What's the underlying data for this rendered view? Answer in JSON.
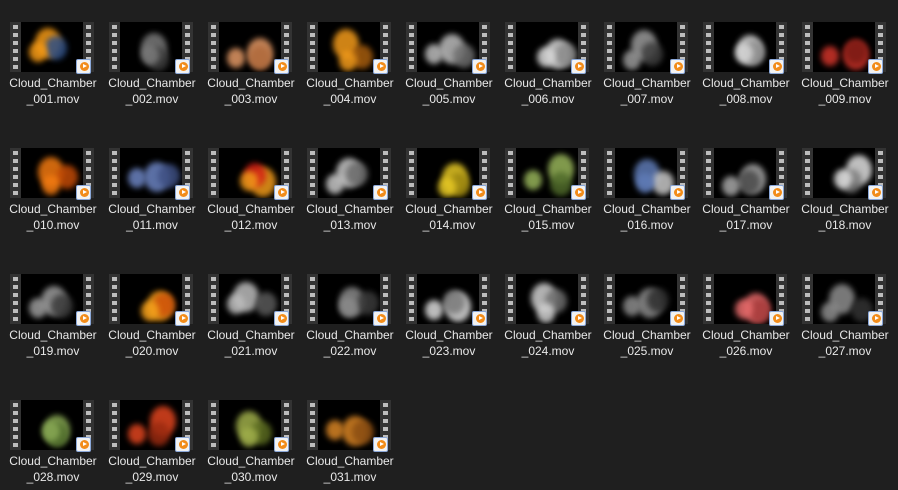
{
  "files": [
    {
      "name1": "Cloud_Chamber",
      "name2": "_001.mov",
      "c1": "#f59a16",
      "c2": "#2e4f86"
    },
    {
      "name1": "Cloud_Chamber",
      "name2": "_002.mov",
      "c1": "#7a7a7a",
      "c2": "#3c3c3c"
    },
    {
      "name1": "Cloud_Chamber",
      "name2": "_003.mov",
      "c1": "#e29865",
      "c2": "#b06a3c"
    },
    {
      "name1": "Cloud_Chamber",
      "name2": "_004.mov",
      "c1": "#f39b1b",
      "c2": "#a65d0e"
    },
    {
      "name1": "Cloud_Chamber",
      "name2": "_005.mov",
      "c1": "#bdbdbd",
      "c2": "#6d6d6d"
    },
    {
      "name1": "Cloud_Chamber",
      "name2": "_006.mov",
      "c1": "#d8d8d8",
      "c2": "#8a8a8a"
    },
    {
      "name1": "Cloud_Chamber",
      "name2": "_007.mov",
      "c1": "#9a9a9a",
      "c2": "#3e3e3e"
    },
    {
      "name1": "Cloud_Chamber",
      "name2": "_008.mov",
      "c1": "#d6d6d6",
      "c2": "#8c8c8c"
    },
    {
      "name1": "Cloud_Chamber",
      "name2": "_009.mov",
      "c1": "#d0342a",
      "c2": "#7a1a14"
    },
    {
      "name1": "Cloud_Chamber",
      "name2": "_010.mov",
      "c1": "#f27a11",
      "c2": "#c24a06"
    },
    {
      "name1": "Cloud_Chamber",
      "name2": "_011.mov",
      "c1": "#6c84c2",
      "c2": "#3e4f82"
    },
    {
      "name1": "Cloud_Chamber",
      "name2": "_012.mov",
      "c1": "#f09a1a",
      "c2": "#d42016"
    },
    {
      "name1": "Cloud_Chamber",
      "name2": "_013.mov",
      "c1": "#c8c8c8",
      "c2": "#6a6a6a"
    },
    {
      "name1": "Cloud_Chamber",
      "name2": "_014.mov",
      "c1": "#e6c825",
      "c2": "#9c8610"
    },
    {
      "name1": "Cloud_Chamber",
      "name2": "_015.mov",
      "c1": "#97b45a",
      "c2": "#4f6a2a"
    },
    {
      "name1": "Cloud_Chamber",
      "name2": "_016.mov",
      "c1": "#5f7bb6",
      "c2": "#c8c8c8"
    },
    {
      "name1": "Cloud_Chamber",
      "name2": "_017.mov",
      "c1": "#a8a8a8",
      "c2": "#4a4a4a"
    },
    {
      "name1": "Cloud_Chamber",
      "name2": "_018.mov",
      "c1": "#e0e0e0",
      "c2": "#7a7a7a"
    },
    {
      "name1": "Cloud_Chamber",
      "name2": "_019.mov",
      "c1": "#9c9c9c",
      "c2": "#3a3a3a"
    },
    {
      "name1": "Cloud_Chamber",
      "name2": "_020.mov",
      "c1": "#f5a11c",
      "c2": "#d0520a"
    },
    {
      "name1": "Cloud_Chamber",
      "name2": "_021.mov",
      "c1": "#bdbdbd",
      "c2": "#5a5a5a"
    },
    {
      "name1": "Cloud_Chamber",
      "name2": "_022.mov",
      "c1": "#8a8a8a",
      "c2": "#3a3a3a"
    },
    {
      "name1": "Cloud_Chamber",
      "name2": "_023.mov",
      "c1": "#dcdcdc",
      "c2": "#7a7a7a"
    },
    {
      "name1": "Cloud_Chamber",
      "name2": "_024.mov",
      "c1": "#d0d0d0",
      "c2": "#6e6e6e"
    },
    {
      "name1": "Cloud_Chamber",
      "name2": "_025.mov",
      "c1": "#8c8c8c",
      "c2": "#2e2e2e"
    },
    {
      "name1": "Cloud_Chamber",
      "name2": "_026.mov",
      "c1": "#e56a6a",
      "c2": "#a83c3c"
    },
    {
      "name1": "Cloud_Chamber",
      "name2": "_027.mov",
      "c1": "#8e8e8e",
      "c2": "#333333"
    },
    {
      "name1": "Cloud_Chamber",
      "name2": "_028.mov",
      "c1": "#89a955",
      "c2": "#4d6a2a"
    },
    {
      "name1": "Cloud_Chamber",
      "name2": "_029.mov",
      "c1": "#e0451f",
      "c2": "#9a2a10"
    },
    {
      "name1": "Cloud_Chamber",
      "name2": "_030.mov",
      "c1": "#9fae4a",
      "c2": "#5a6a20"
    },
    {
      "name1": "Cloud_Chamber",
      "name2": "_031.mov",
      "c1": "#d98525",
      "c2": "#8a4d12"
    }
  ]
}
